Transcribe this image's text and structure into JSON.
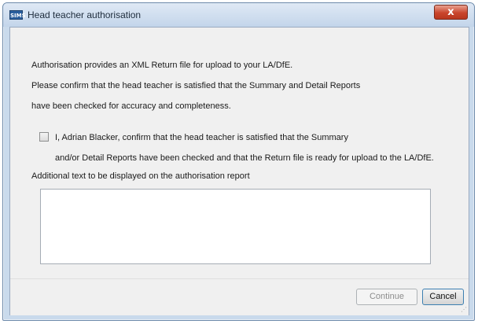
{
  "window": {
    "icon_text": "SIMS",
    "title": "Head teacher authorisation",
    "close_glyph": "x"
  },
  "body": {
    "line1": "Authorisation provides an XML Return file for upload to your LA/DfE.",
    "line2": "Please confirm that the head teacher is satisfied that the Summary and Detail Reports",
    "line3": "have been checked for accuracy and completeness.",
    "confirm_line1": "I, Adrian Blacker, confirm that the head teacher is satisfied that the Summary",
    "confirm_line2": "and/or Detail Reports have been checked and that the Return file is ready for upload to the LA/DfE.",
    "additional_label": "Additional text to be displayed on the authorisation report",
    "additional_value": ""
  },
  "buttons": {
    "continue": "Continue",
    "cancel": "Cancel"
  },
  "state": {
    "confirm_checked": false,
    "continue_enabled": false
  },
  "colors": {
    "title_bar": "#c3d5ea",
    "close_button": "#c9452c",
    "client_background": "#f0f0f0",
    "default_button_border": "#3c7fb1"
  },
  "icons": {
    "app": "sims-app-icon",
    "close": "close-icon",
    "resize": "resize-grip-icon"
  }
}
